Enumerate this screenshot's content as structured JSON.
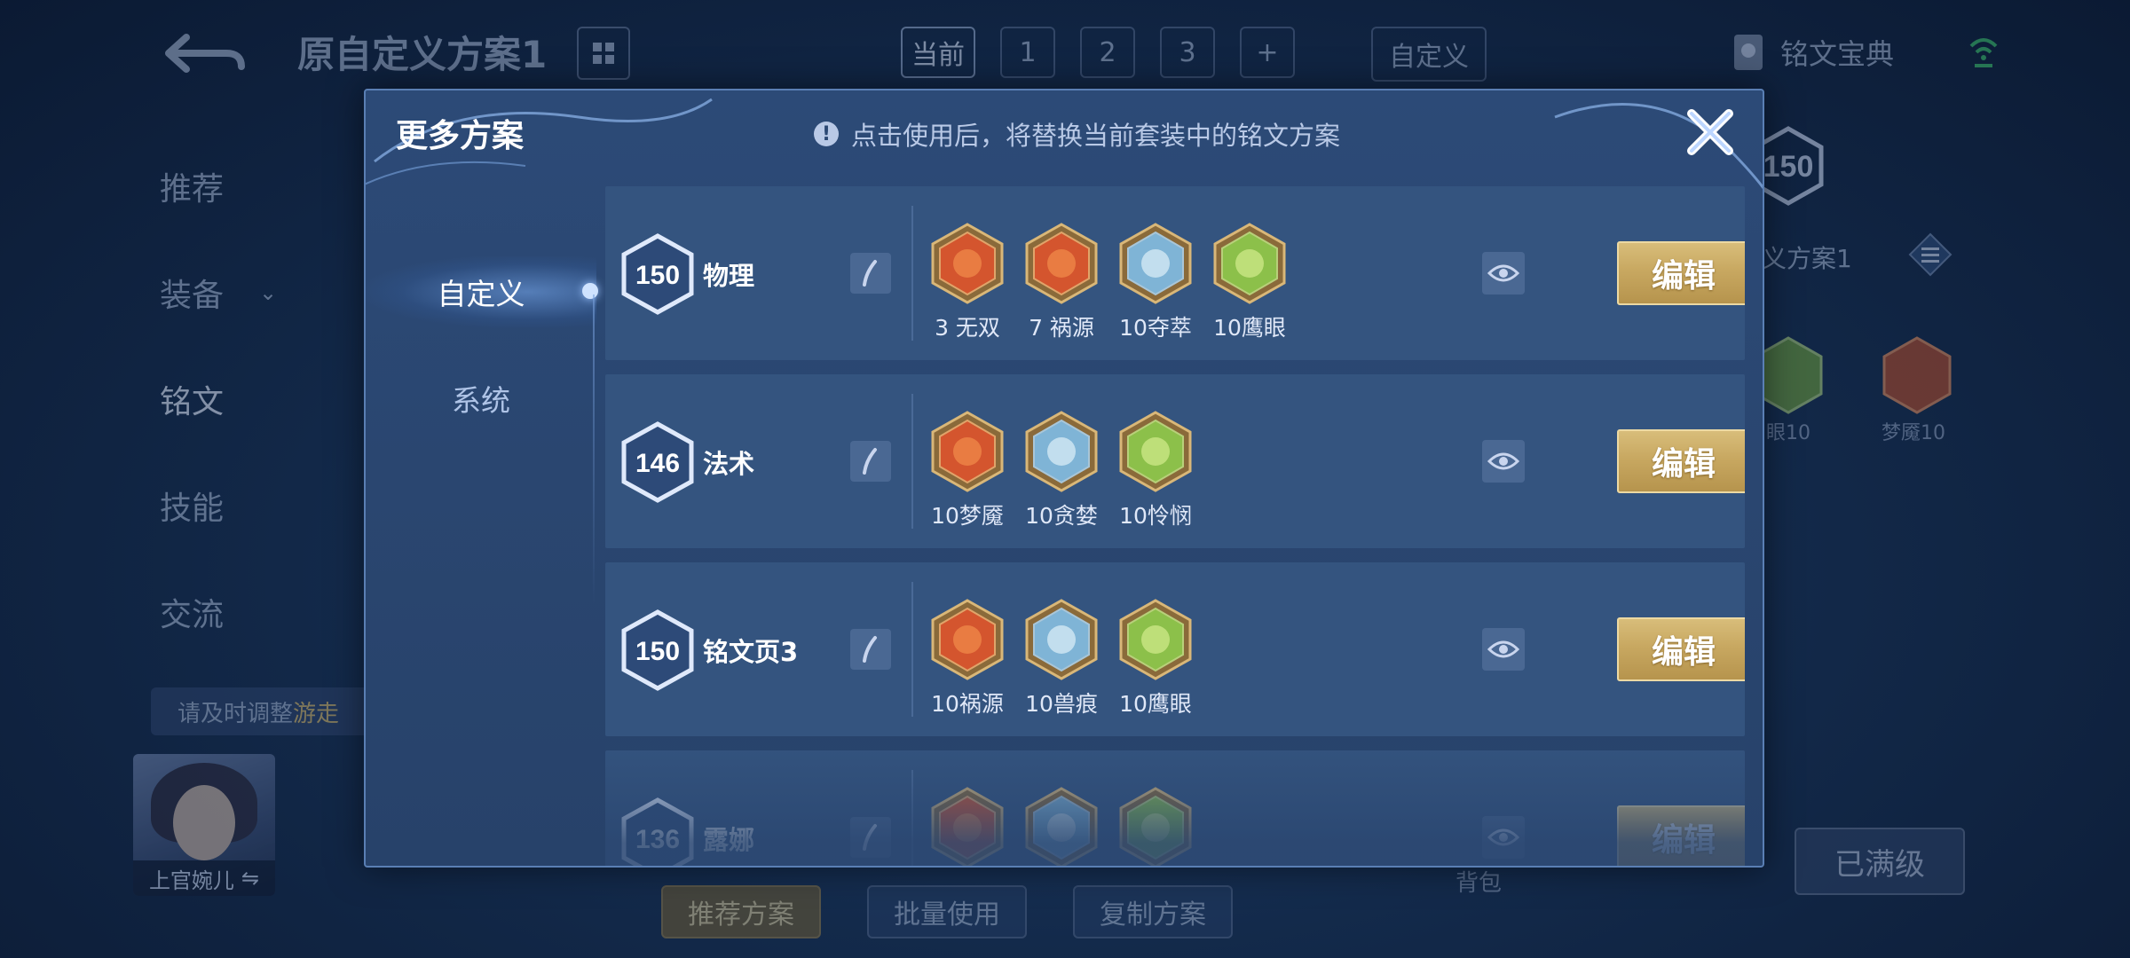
{
  "background": {
    "page_title": "原自定义方案1",
    "page_tabs": [
      "当前",
      "1",
      "2",
      "3",
      "+"
    ],
    "custom_tab": "自定义",
    "codex_label": "铭文宝典",
    "side_nav": [
      "推荐",
      "装备",
      "铭文",
      "技能",
      "交流"
    ],
    "notice_text": "请及时调整",
    "notice_highlight": "游走",
    "hero_name": "上官婉儿",
    "bottom_buttons": [
      "推荐方案",
      "批量使用",
      "复制方案"
    ],
    "bag_label": "背包",
    "max_level_label": "已满级",
    "right_panel": {
      "level": "150",
      "title": "义方案1",
      "runes": [
        "眼10",
        "梦魇10"
      ]
    }
  },
  "modal": {
    "title": "更多方案",
    "tip": "点击使用后，将替换当前套装中的铭文方案",
    "tabs": [
      "自定义",
      "系统"
    ],
    "edit_label": "编辑",
    "schemes": [
      {
        "level": "150",
        "name": "物理",
        "runes": [
          {
            "label": "3 无双",
            "color": "red"
          },
          {
            "label": "7 祸源",
            "color": "red"
          },
          {
            "label": "10夺萃",
            "color": "blue"
          },
          {
            "label": "10鹰眼",
            "color": "green"
          }
        ]
      },
      {
        "level": "146",
        "name": "法术",
        "runes": [
          {
            "label": "10梦魇",
            "color": "red"
          },
          {
            "label": "10贪婪",
            "color": "blue"
          },
          {
            "label": "10怜悯",
            "color": "green"
          }
        ]
      },
      {
        "level": "150",
        "name": "铭文页3",
        "runes": [
          {
            "label": "10祸源",
            "color": "red"
          },
          {
            "label": "10兽痕",
            "color": "blue"
          },
          {
            "label": "10鹰眼",
            "color": "green"
          }
        ]
      },
      {
        "level": "136",
        "name": "露娜",
        "runes": [
          {
            "label": "",
            "color": "red"
          },
          {
            "label": "",
            "color": "blue"
          },
          {
            "label": "",
            "color": "green"
          }
        ]
      }
    ]
  },
  "colors": {
    "rune_red": "#d4552e",
    "rune_blue": "#7fb4d6",
    "rune_green": "#8cc04a",
    "edit_gold": "#c8a861",
    "modal_bg": "#2a4670"
  }
}
